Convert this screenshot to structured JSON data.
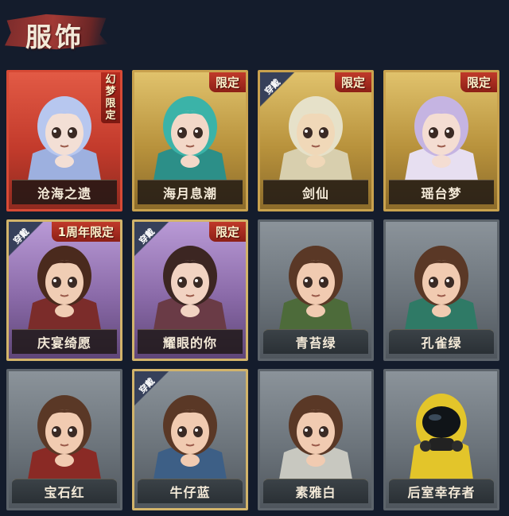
{
  "header": {
    "title": "服饰"
  },
  "colors": {
    "background": "#141c2c",
    "rare_gold": "#c9a24e",
    "rare_red": "#d74a35",
    "rare_purple": "#8a6aa8",
    "basic_gray": "#6c747b",
    "badge_red": "#a02a1e"
  },
  "costumes": [
    {
      "name": "沧海之遗",
      "rarity": "red",
      "badge": "幻梦限定",
      "equipped": false,
      "portrait": "blue-haired-woman-portrait"
    },
    {
      "name": "海月息潮",
      "rarity": "gold",
      "badge": "限定",
      "equipped": false,
      "portrait": "teal-haired-woman-portrait"
    },
    {
      "name": "剑仙",
      "rarity": "gold",
      "badge": "限定",
      "equipped": true,
      "portrait": "white-haired-swordsman-portrait"
    },
    {
      "name": "瑶台梦",
      "rarity": "gold",
      "badge": "限定",
      "equipped": false,
      "portrait": "lavender-haired-woman-portrait"
    },
    {
      "name": "庆宴绮愿",
      "rarity": "purple",
      "badge": "1周年限定",
      "equipped": true,
      "portrait": "party-girl-with-cake-portrait"
    },
    {
      "name": "耀眼的你",
      "rarity": "purple",
      "badge": "限定",
      "equipped": true,
      "portrait": "cowboy-hat-girl-portrait"
    },
    {
      "name": "青苔绿",
      "rarity": "gray",
      "badge": "",
      "equipped": false,
      "portrait": "girl-green-coat-portrait"
    },
    {
      "name": "孔雀绿",
      "rarity": "gray",
      "badge": "",
      "equipped": false,
      "portrait": "girl-teal-coat-portrait"
    },
    {
      "name": "宝石红",
      "rarity": "gray",
      "badge": "",
      "equipped": false,
      "portrait": "girl-red-coat-portrait"
    },
    {
      "name": "牛仔蓝",
      "rarity": "gray",
      "badge": "",
      "equipped": true,
      "portrait": "girl-blue-coat-portrait"
    },
    {
      "name": "素雅白",
      "rarity": "gray",
      "badge": "",
      "equipped": false,
      "portrait": "girl-white-coat-portrait"
    },
    {
      "name": "后室幸存者",
      "rarity": "gray",
      "badge": "",
      "equipped": false,
      "portrait": "yellow-hazmat-survivor-portrait"
    }
  ],
  "labels": {
    "equipped": "穿戴"
  }
}
